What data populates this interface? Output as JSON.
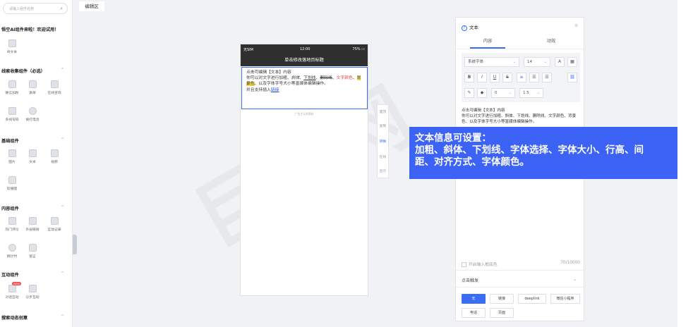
{
  "sidebar": {
    "search_placeholder": "请输入组件名称",
    "promo": "悟空AI组件来啦！欢迎试用！",
    "ai_item": "AI文本",
    "sections": {
      "leads": "线索收集组件（必选）",
      "basic": "基础组件",
      "content": "内容组件",
      "interact": "互动组件",
      "search": "搜索动态创意"
    },
    "leads_items": [
      "微信加粉",
      "表单",
      "在线咨询",
      "多线号码",
      "拨打电话"
    ],
    "basic_items": [
      "图片",
      "文本",
      "视频",
      "轮播图"
    ],
    "content_items": [
      "热门评论",
      "外层链接",
      "互动记录",
      "倒计时",
      "留言"
    ],
    "interact_items": [
      "对话互动",
      "分步互动"
    ],
    "new_badge": "NEW"
  },
  "canvas": {
    "tab": "编辑区",
    "status_left": "无SIM",
    "status_time": "12:00",
    "status_battery": "75%",
    "nav_title": "单击修改落地页标题",
    "text_line1": "点击可编辑【文本】内容",
    "text_line2_a": "你可以对文字进行加粗、",
    "text_italic": "斜体",
    "text_comma1": "、",
    "text_underline": "下划线",
    "text_comma2": "、",
    "text_strike": "删除线",
    "text_comma3": "、",
    "text_color": "文字颜色",
    "text_comma4": "、",
    "text_bg": "背景色",
    "text_rest": "、以及字体字号大小等富媒体编辑操作。",
    "text_line4_a": "并且支持插入",
    "text_link": "链接",
    "footer": "广告主无关资料",
    "sidetools": [
      "置顶",
      "复制",
      "转换",
      "在线",
      "显示"
    ]
  },
  "panel": {
    "title": "文本",
    "tabs": [
      "内容",
      "动效"
    ],
    "font_select": "系统字体",
    "size_select": "14",
    "letter_spacing": "0",
    "line_height": "1.5",
    "preview_line1": "点击可编辑【文本】内容",
    "preview_line2": "你可以对文字进行加粗、斜体、下划线、删除线、文字颜色、背景色、以及字体字号大小等富媒体编辑操作。",
    "counter_label": "开启输入框底色",
    "counter_value": "70/10000",
    "trigger_label": "点击触发",
    "trigger_options": [
      "无",
      "链接",
      "deeplink",
      "微信小程序",
      "电话",
      "页面"
    ]
  },
  "banner": {
    "line1": "文本信息可设置：",
    "line2": "加粗、斜体、下划线、字体选择、字体大小、行高、间",
    "line3": "距、对齐方式、字体颜色。"
  },
  "watermark": "巨官网",
  "colors": {
    "accent": "#3a6cf4",
    "banner": "#3c63f5",
    "phone_bar": "#2f2f2f"
  }
}
